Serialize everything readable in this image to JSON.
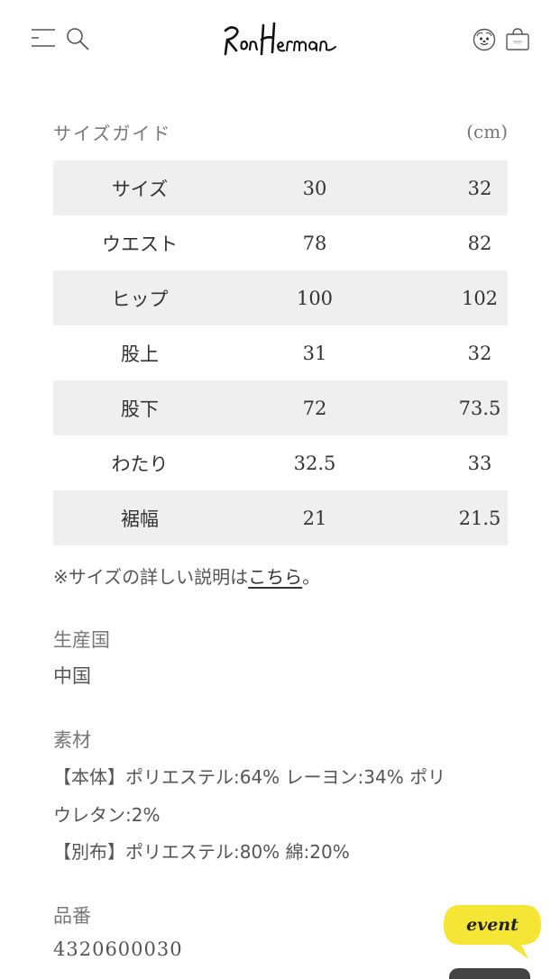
{
  "header": {
    "logo_text": "RonHerman"
  },
  "size_guide": {
    "title": "サイズガイド",
    "unit": "(cm)",
    "rows": [
      {
        "label": "サイズ",
        "v1": "30",
        "v2": "32"
      },
      {
        "label": "ウエスト",
        "v1": "78",
        "v2": "82"
      },
      {
        "label": "ヒップ",
        "v1": "100",
        "v2": "102"
      },
      {
        "label": "股上",
        "v1": "31",
        "v2": "32"
      },
      {
        "label": "股下",
        "v1": "72",
        "v2": "73.5"
      },
      {
        "label": "わたり",
        "v1": "32.5",
        "v2": "33"
      },
      {
        "label": "裾幅",
        "v1": "21",
        "v2": "21.5"
      }
    ],
    "note_prefix": "※サイズの詳しい説明は",
    "note_link": "こちら",
    "note_suffix": "。"
  },
  "origin": {
    "label": "生産国",
    "value": "中国"
  },
  "material": {
    "label": "素材",
    "lines": [
      "【本体】ポリエステル:64% レーヨン:34% ポリ",
      "ウレタン:2%",
      "【別布】ポリエステル:80% 綿:20%"
    ]
  },
  "product": {
    "label": "品番",
    "number": "4320600030"
  },
  "event_badge": {
    "label": "event",
    "color": "#f5e534"
  },
  "colors": {
    "row_shade": "#efefef",
    "text": "#333333",
    "muted": "#777777"
  }
}
